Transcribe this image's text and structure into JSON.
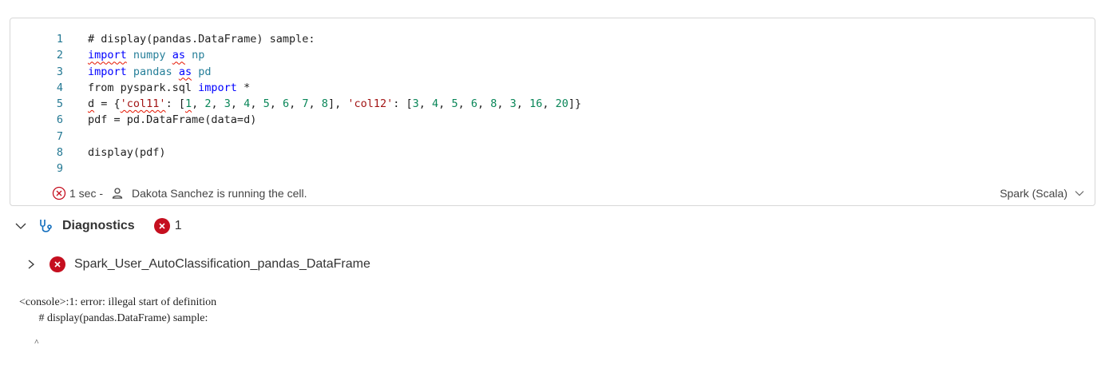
{
  "editor": {
    "lines": [
      {
        "num": "1",
        "segments": [
          {
            "t": "# display(pandas.DataFrame) sample:",
            "c": "cm"
          }
        ]
      },
      {
        "num": "2",
        "segments": [
          {
            "t": "import",
            "c": "kw",
            "sq": true
          },
          {
            "t": " ",
            "c": ""
          },
          {
            "t": "numpy",
            "c": "mod"
          },
          {
            "t": " ",
            "c": ""
          },
          {
            "t": "as",
            "c": "kw",
            "sq": true
          },
          {
            "t": " ",
            "c": ""
          },
          {
            "t": "np",
            "c": "mod"
          }
        ]
      },
      {
        "num": "3",
        "segments": [
          {
            "t": "import",
            "c": "kw"
          },
          {
            "t": " ",
            "c": ""
          },
          {
            "t": "pandas",
            "c": "mod"
          },
          {
            "t": " ",
            "c": ""
          },
          {
            "t": "as",
            "c": "kw",
            "sq": true
          },
          {
            "t": " ",
            "c": ""
          },
          {
            "t": "pd",
            "c": "mod"
          }
        ]
      },
      {
        "num": "4",
        "segments": [
          {
            "t": "from pyspark.sql ",
            "c": ""
          },
          {
            "t": "import",
            "c": "kw"
          },
          {
            "t": " *",
            "c": ""
          }
        ]
      },
      {
        "num": "5",
        "segments": [
          {
            "t": "d",
            "c": "",
            "sq": true
          },
          {
            "t": " = {",
            "c": ""
          },
          {
            "t": "'col11'",
            "c": "str",
            "sq": true
          },
          {
            "t": ": [",
            "c": ""
          },
          {
            "t": "1",
            "c": "num",
            "sq": true
          },
          {
            "t": ", ",
            "c": ""
          },
          {
            "t": "2",
            "c": "num"
          },
          {
            "t": ", ",
            "c": ""
          },
          {
            "t": "3",
            "c": "num"
          },
          {
            "t": ", ",
            "c": ""
          },
          {
            "t": "4",
            "c": "num"
          },
          {
            "t": ", ",
            "c": ""
          },
          {
            "t": "5",
            "c": "num"
          },
          {
            "t": ", ",
            "c": ""
          },
          {
            "t": "6",
            "c": "num"
          },
          {
            "t": ", ",
            "c": ""
          },
          {
            "t": "7",
            "c": "num"
          },
          {
            "t": ", ",
            "c": ""
          },
          {
            "t": "8",
            "c": "num"
          },
          {
            "t": "], ",
            "c": ""
          },
          {
            "t": "'col12'",
            "c": "str"
          },
          {
            "t": ": [",
            "c": ""
          },
          {
            "t": "3",
            "c": "num"
          },
          {
            "t": ", ",
            "c": ""
          },
          {
            "t": "4",
            "c": "num"
          },
          {
            "t": ", ",
            "c": ""
          },
          {
            "t": "5",
            "c": "num"
          },
          {
            "t": ", ",
            "c": ""
          },
          {
            "t": "6",
            "c": "num"
          },
          {
            "t": ", ",
            "c": ""
          },
          {
            "t": "8",
            "c": "num"
          },
          {
            "t": ", ",
            "c": ""
          },
          {
            "t": "3",
            "c": "num"
          },
          {
            "t": ", ",
            "c": ""
          },
          {
            "t": "16",
            "c": "num"
          },
          {
            "t": ", ",
            "c": ""
          },
          {
            "t": "20",
            "c": "num"
          },
          {
            "t": "]}",
            "c": ""
          }
        ]
      },
      {
        "num": "6",
        "segments": [
          {
            "t": "pdf = pd.DataFrame(data=d)",
            "c": ""
          }
        ]
      },
      {
        "num": "7",
        "segments": []
      },
      {
        "num": "8",
        "segments": [
          {
            "t": "display(pdf)",
            "c": ""
          }
        ]
      },
      {
        "num": "9",
        "segments": []
      }
    ]
  },
  "status": {
    "duration": "1 sec -",
    "message": "Dakota Sanchez is running the cell.",
    "language": "Spark (Scala)"
  },
  "diagnostics": {
    "title": "Diagnostics",
    "count": "1",
    "item_label": "Spark_User_AutoClassification_pandas_DataFrame"
  },
  "console": {
    "line1": "<console>:1: error: illegal start of definition",
    "line2": "       # display(pandas.DataFrame) sample:",
    "line3": "       ^"
  },
  "colors": {
    "error": "#c50f1f",
    "accent": "#0f6cbd"
  }
}
